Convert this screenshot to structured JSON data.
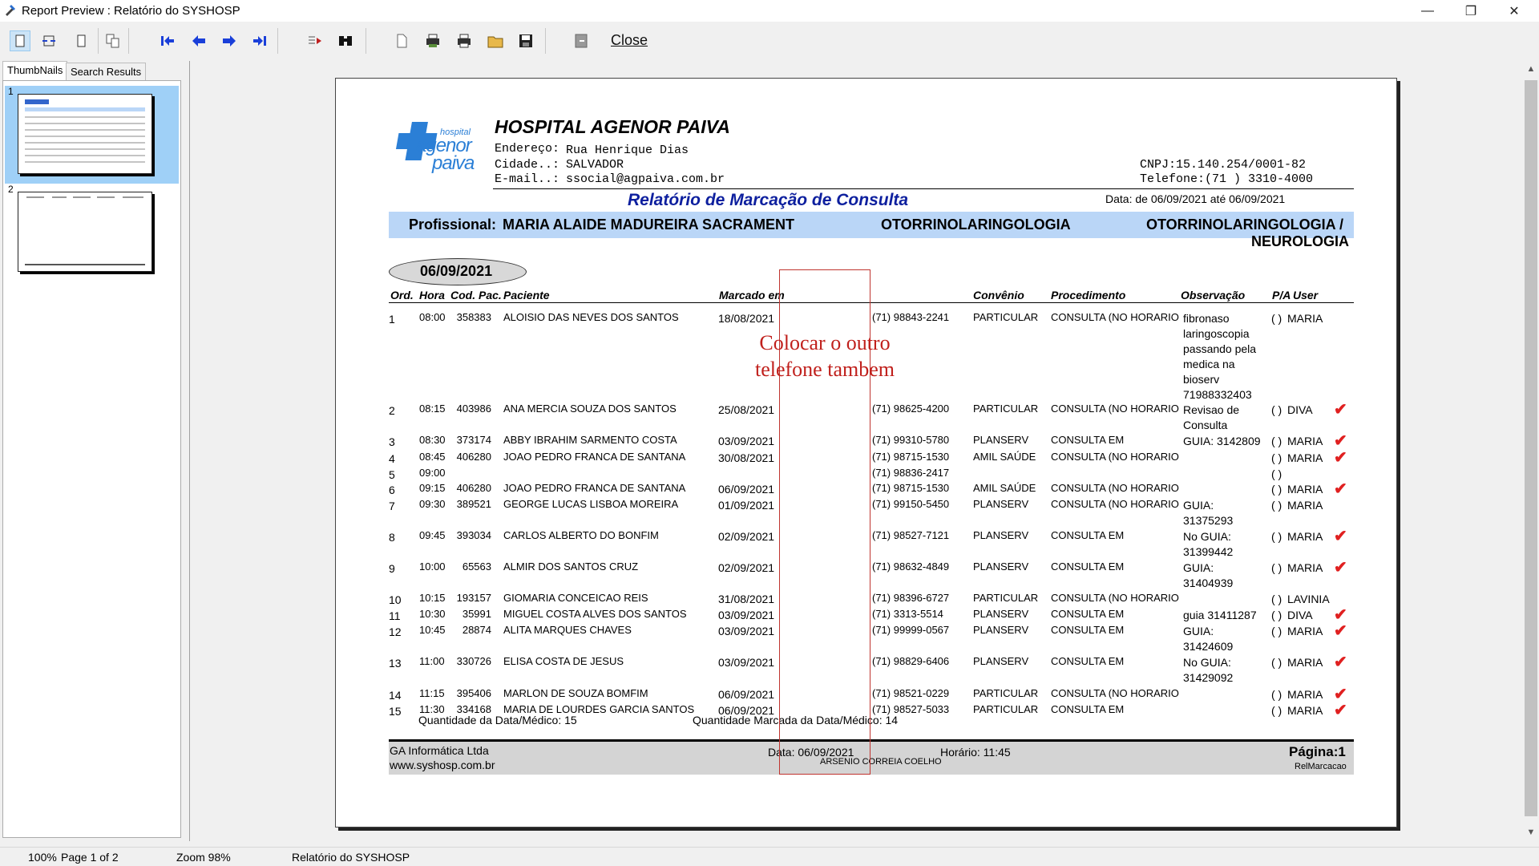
{
  "window": {
    "title": "Report Preview : Relatório do SYSHOSP"
  },
  "toolbar": {
    "close_label": "Close"
  },
  "panel": {
    "tabs": [
      "ThumbNails",
      "Search Results"
    ],
    "thumbs": [
      {
        "num": "1"
      },
      {
        "num": "2"
      }
    ]
  },
  "report": {
    "hospital_name": "HOSPITAL AGENOR PAIVA",
    "logo_text": {
      "small": "hospital",
      "line1": "agenor",
      "line2": "paiva"
    },
    "address_label": "Endereço:",
    "address": "Rua Henrique Dias",
    "city_label": "Cidade..:",
    "city": "SALVADOR",
    "email_label": "E-mail..:",
    "email": "ssocial@agpaiva.com.br",
    "cnpj": "CNPJ:15.140.254/0001-82",
    "telefone": "Telefone:(71 ) 3310-4000",
    "report_title": "Relatório de Marcação de Consulta",
    "date_range": "Data: de 06/09/2021   até  06/09/2021",
    "prof_label": "Profissional:",
    "prof_name": "MARIA ALAIDE MADUREIRA SACRAMENT",
    "specialty1": "OTORRINOLARINGOLOGIA",
    "specialty2_a": "OTORRINOLARINGOLOGIA /",
    "specialty2_b": "NEUROLOGIA",
    "date_badge": "06/09/2021",
    "columns": {
      "ord": "Ord.",
      "hora": "Hora",
      "cod": "Cod. Pac.",
      "paciente": "Paciente",
      "marcado": "Marcado em",
      "convenio": "Convênio",
      "procedimento": "Procedimento",
      "observacao": "Observação",
      "pa": "P/A",
      "user": "User"
    },
    "rows": [
      {
        "ord": "1",
        "hora": "08:00",
        "cod": "358383",
        "paciente": "ALOISIO DAS NEVES DOS SANTOS",
        "marcado": "18/08/2021",
        "fone": "(71) 98843-2241",
        "convenio": "PARTICULAR",
        "proc": "CONSULTA (NO HORARIO",
        "obs": [
          "fibronaso",
          "laringoscopia",
          "passando pela",
          "medica na",
          "bioserv",
          "71988332403"
        ],
        "pa": "(   )",
        "user": "MARIA",
        "check": false
      },
      {
        "ord": "2",
        "hora": "08:15",
        "cod": "403986",
        "paciente": "ANA MERCIA SOUZA DOS SANTOS",
        "marcado": "25/08/2021",
        "fone": "(71) 98625-4200",
        "convenio": "PARTICULAR",
        "proc": "CONSULTA (NO HORARIO",
        "obs": [
          "Revisao de",
          "Consulta"
        ],
        "pa": "(   )",
        "user": "DIVA",
        "check": true
      },
      {
        "ord": "3",
        "hora": "08:30",
        "cod": "373174",
        "paciente": "ABBY IBRAHIM SARMENTO COSTA",
        "marcado": "03/09/2021",
        "fone": "(71) 99310-5780",
        "convenio": "PLANSERV",
        "proc": "CONSULTA EM",
        "obs": [
          "GUIA: 3142809"
        ],
        "pa": "(   )",
        "user": "MARIA",
        "check": true
      },
      {
        "ord": "4",
        "hora": "08:45",
        "cod": "406280",
        "paciente": "JOAO PEDRO FRANCA DE SANTANA",
        "marcado": "30/08/2021",
        "fone": "(71) 98715-1530",
        "convenio": "AMIL SAÚDE",
        "proc": "CONSULTA (NO HORARIO",
        "obs": [],
        "pa": "(   )",
        "user": "MARIA",
        "check": true
      },
      {
        "ord": "5",
        "hora": "09:00",
        "cod": "",
        "paciente": "",
        "marcado": "",
        "fone": "(71) 98836-2417",
        "convenio": "",
        "proc": "",
        "obs": [],
        "pa": "(   )",
        "user": "",
        "check": false
      },
      {
        "ord": "6",
        "hora": "09:15",
        "cod": "406280",
        "paciente": "JOAO PEDRO FRANCA DE SANTANA",
        "marcado": "06/09/2021",
        "fone": "(71) 98715-1530",
        "convenio": "AMIL SAÚDE",
        "proc": "CONSULTA (NO HORARIO",
        "obs": [],
        "pa": "(   )",
        "user": "MARIA",
        "check": true
      },
      {
        "ord": "7",
        "hora": "09:30",
        "cod": "389521",
        "paciente": "GEORGE LUCAS LISBOA MOREIRA",
        "marcado": "01/09/2021",
        "fone": "(71) 99150-5450",
        "convenio": "PLANSERV",
        "proc": "CONSULTA (NO HORARIO",
        "obs": [
          "GUIA:",
          "31375293"
        ],
        "pa": "(   )",
        "user": "MARIA",
        "check": false
      },
      {
        "ord": "8",
        "hora": "09:45",
        "cod": "393034",
        "paciente": "CARLOS ALBERTO DO BONFIM",
        "marcado": "02/09/2021",
        "fone": "(71) 98527-7121",
        "convenio": "PLANSERV",
        "proc": "CONSULTA EM",
        "obs": [
          "No GUIA:",
          "31399442"
        ],
        "pa": "(   )",
        "user": "MARIA",
        "check": true
      },
      {
        "ord": "9",
        "hora": "10:00",
        "cod": "65563",
        "paciente": "ALMIR DOS SANTOS CRUZ",
        "marcado": "02/09/2021",
        "fone": "(71) 98632-4849",
        "convenio": "PLANSERV",
        "proc": "CONSULTA EM",
        "obs": [
          " GUIA:",
          "31404939"
        ],
        "pa": "(   )",
        "user": "MARIA",
        "check": true
      },
      {
        "ord": "10",
        "hora": "10:15",
        "cod": "193157",
        "paciente": "GIOMARIA CONCEICAO REIS",
        "marcado": "31/08/2021",
        "fone": "(71) 98396-6727",
        "convenio": "PARTICULAR",
        "proc": "CONSULTA (NO HORARIO",
        "obs": [],
        "pa": "(   )",
        "user": "LAVINIA",
        "check": false
      },
      {
        "ord": "11",
        "hora": "10:30",
        "cod": "35991",
        "paciente": "MIGUEL COSTA ALVES DOS SANTOS",
        "marcado": "03/09/2021",
        "fone": "(71)  3313-5514",
        "convenio": "PLANSERV",
        "proc": "CONSULTA EM",
        "obs": [
          "guia 31411287"
        ],
        "pa": "(   )",
        "user": "DIVA",
        "check": true
      },
      {
        "ord": "12",
        "hora": "10:45",
        "cod": "28874",
        "paciente": "ALITA MARQUES CHAVES",
        "marcado": "03/09/2021",
        "fone": "(71) 99999-0567",
        "convenio": "PLANSERV",
        "proc": "CONSULTA EM",
        "obs": [
          "GUIA:",
          "31424609"
        ],
        "pa": "(   )",
        "user": "MARIA",
        "check": true
      },
      {
        "ord": "13",
        "hora": "11:00",
        "cod": "330726",
        "paciente": "ELISA COSTA DE JESUS",
        "marcado": "03/09/2021",
        "fone": "(71) 98829-6406",
        "convenio": "PLANSERV",
        "proc": "CONSULTA EM",
        "obs": [
          "No GUIA:",
          "31429092"
        ],
        "pa": "(   )",
        "user": "MARIA",
        "check": true
      },
      {
        "ord": "14",
        "hora": "11:15",
        "cod": "395406",
        "paciente": "MARLON DE SOUZA BOMFIM",
        "marcado": "06/09/2021",
        "fone": "(71) 98521-0229",
        "convenio": "PARTICULAR",
        "proc": "CONSULTA (NO HORARIO",
        "obs": [],
        "pa": "(   )",
        "user": "MARIA",
        "check": true
      },
      {
        "ord": "15",
        "hora": "11:30",
        "cod": "334168",
        "paciente": "MARIA DE LOURDES GARCIA SANTOS",
        "marcado": "06/09/2021",
        "fone": "(71) 98527-5033",
        "convenio": "PARTICULAR",
        "proc": "CONSULTA EM",
        "obs": [],
        "pa": "(   )",
        "user": "MARIA",
        "check": true
      }
    ],
    "qty_data_medico": "Quantidade da Data/Médico: 15",
    "qty_marcada": "Quantidade Marcada da Data/Médico: 14",
    "footer": {
      "company": "GA Informática Ltda",
      "site": "www.syshosp.com.br",
      "data": "Data:  06/09/2021",
      "user": "ARSENIO CORREIA COELHO",
      "horario": "Horário:  11:45",
      "pagina": "Página:1",
      "report_id": "RelMarcacao"
    }
  },
  "annotation": {
    "line1": "Colocar o outro",
    "line2": "telefone tambem",
    "color": "#c0201c"
  },
  "status": {
    "zoom_pct": "100%",
    "page_of": "Page 1 of 2",
    "zoom": "Zoom 98%",
    "report_name": "Relatório do SYSHOSP"
  }
}
